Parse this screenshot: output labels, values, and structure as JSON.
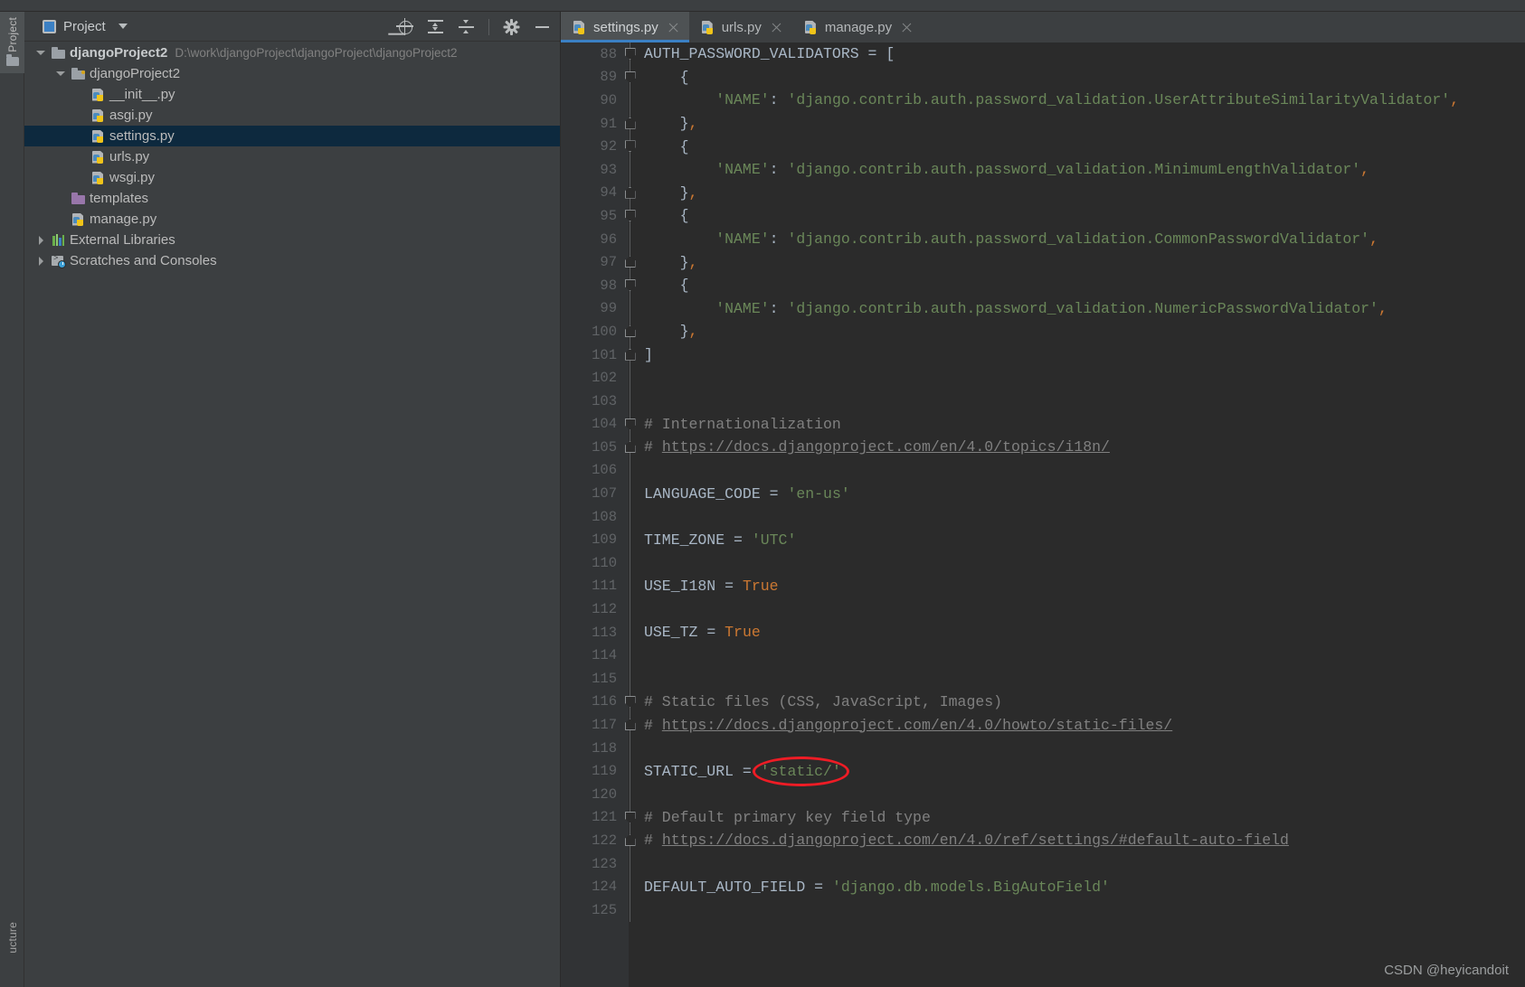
{
  "window": {
    "watermark": "CSDN @heyicandoit"
  },
  "rail": {
    "project_label": "Project",
    "structure_label": "ucture"
  },
  "project_panel": {
    "title": "Project",
    "icon": "project-window-icon",
    "tools": [
      {
        "name": "locate-in-tree-icon",
        "label": "Select Opened File"
      },
      {
        "name": "expand-all-icon",
        "label": "Expand All"
      },
      {
        "name": "collapse-all-icon",
        "label": "Collapse All"
      },
      {
        "name": "gear-icon",
        "label": "Options"
      },
      {
        "name": "minimize-icon",
        "label": "Hide"
      }
    ],
    "tree": [
      {
        "depth": 0,
        "arrow": "down",
        "icon": "folder-module-icon",
        "label": "djangoProject2",
        "bold": true,
        "path": "D:\\work\\djangoProject\\djangoProject\\djangoProject2",
        "selected": false
      },
      {
        "depth": 1,
        "arrow": "down",
        "icon": "folder-package-icon",
        "label": "djangoProject2",
        "bold": false,
        "path": "",
        "selected": false
      },
      {
        "depth": 2,
        "arrow": "none",
        "icon": "python-file-icon",
        "label": "__init__.py",
        "bold": false,
        "path": "",
        "selected": false
      },
      {
        "depth": 2,
        "arrow": "none",
        "icon": "python-file-icon",
        "label": "asgi.py",
        "bold": false,
        "path": "",
        "selected": false
      },
      {
        "depth": 2,
        "arrow": "none",
        "icon": "python-file-icon",
        "label": "settings.py",
        "bold": false,
        "path": "",
        "selected": true
      },
      {
        "depth": 2,
        "arrow": "none",
        "icon": "python-file-icon",
        "label": "urls.py",
        "bold": false,
        "path": "",
        "selected": false
      },
      {
        "depth": 2,
        "arrow": "none",
        "icon": "python-file-icon",
        "label": "wsgi.py",
        "bold": false,
        "path": "",
        "selected": false
      },
      {
        "depth": 1,
        "arrow": "none",
        "icon": "folder-templates-icon",
        "label": "templates",
        "bold": false,
        "path": "",
        "selected": false
      },
      {
        "depth": 1,
        "arrow": "none",
        "icon": "python-file-icon",
        "label": "manage.py",
        "bold": false,
        "path": "",
        "selected": false
      },
      {
        "depth": 0,
        "arrow": "right",
        "icon": "external-libraries-icon",
        "label": "External Libraries",
        "bold": false,
        "path": "",
        "selected": false
      },
      {
        "depth": 0,
        "arrow": "right",
        "icon": "scratches-icon",
        "label": "Scratches and Consoles",
        "bold": false,
        "path": "",
        "selected": false
      }
    ]
  },
  "editor": {
    "tabs": [
      {
        "label": "settings.py",
        "icon": "python-file-icon",
        "active": true,
        "closable": true
      },
      {
        "label": "urls.py",
        "icon": "python-file-icon",
        "active": false,
        "closable": true
      },
      {
        "label": "manage.py",
        "icon": "python-file-icon",
        "active": false,
        "closable": true
      }
    ],
    "first_line_number": 88,
    "annotation": {
      "type": "red-ellipse",
      "target_text": "'static/'",
      "color": "#ee1c25"
    },
    "lines": [
      {
        "n": 88,
        "fold": "open",
        "indent": 0,
        "tokens": [
          {
            "t": "AUTH_PASSWORD_VALIDATORS",
            "c": "tk-const"
          },
          {
            "t": " = ",
            "c": "tk-eq"
          },
          {
            "t": "[",
            "c": "tk-bracket"
          }
        ]
      },
      {
        "n": 89,
        "fold": "open",
        "indent": 1,
        "tokens": [
          {
            "t": "{",
            "c": "tk-bracket"
          }
        ]
      },
      {
        "n": 90,
        "fold": "pipe",
        "indent": 2,
        "tokens": [
          {
            "t": "'NAME'",
            "c": "tk-str"
          },
          {
            "t": ": ",
            "c": "tk-eq"
          },
          {
            "t": "'django.contrib.auth.password_validation.UserAttributeSimilarityValidator'",
            "c": "tk-str"
          },
          {
            "t": ",",
            "c": "tk-punct"
          }
        ]
      },
      {
        "n": 91,
        "fold": "close",
        "indent": 1,
        "tokens": [
          {
            "t": "}",
            "c": "tk-bracket"
          },
          {
            "t": ",",
            "c": "tk-punct"
          }
        ]
      },
      {
        "n": 92,
        "fold": "open",
        "indent": 1,
        "tokens": [
          {
            "t": "{",
            "c": "tk-bracket"
          }
        ]
      },
      {
        "n": 93,
        "fold": "pipe",
        "indent": 2,
        "tokens": [
          {
            "t": "'NAME'",
            "c": "tk-str"
          },
          {
            "t": ": ",
            "c": "tk-eq"
          },
          {
            "t": "'django.contrib.auth.password_validation.MinimumLengthValidator'",
            "c": "tk-str"
          },
          {
            "t": ",",
            "c": "tk-punct"
          }
        ]
      },
      {
        "n": 94,
        "fold": "close",
        "indent": 1,
        "tokens": [
          {
            "t": "}",
            "c": "tk-bracket"
          },
          {
            "t": ",",
            "c": "tk-punct"
          }
        ]
      },
      {
        "n": 95,
        "fold": "open",
        "indent": 1,
        "tokens": [
          {
            "t": "{",
            "c": "tk-bracket"
          }
        ]
      },
      {
        "n": 96,
        "fold": "pipe",
        "indent": 2,
        "tokens": [
          {
            "t": "'NAME'",
            "c": "tk-str"
          },
          {
            "t": ": ",
            "c": "tk-eq"
          },
          {
            "t": "'django.contrib.auth.password_validation.CommonPasswordValidator'",
            "c": "tk-str"
          },
          {
            "t": ",",
            "c": "tk-punct"
          }
        ]
      },
      {
        "n": 97,
        "fold": "close",
        "indent": 1,
        "tokens": [
          {
            "t": "}",
            "c": "tk-bracket"
          },
          {
            "t": ",",
            "c": "tk-punct"
          }
        ]
      },
      {
        "n": 98,
        "fold": "open",
        "indent": 1,
        "tokens": [
          {
            "t": "{",
            "c": "tk-bracket"
          }
        ]
      },
      {
        "n": 99,
        "fold": "pipe",
        "indent": 2,
        "tokens": [
          {
            "t": "'NAME'",
            "c": "tk-str"
          },
          {
            "t": ": ",
            "c": "tk-eq"
          },
          {
            "t": "'django.contrib.auth.password_validation.NumericPasswordValidator'",
            "c": "tk-str"
          },
          {
            "t": ",",
            "c": "tk-punct"
          }
        ]
      },
      {
        "n": 100,
        "fold": "close",
        "indent": 1,
        "tokens": [
          {
            "t": "}",
            "c": "tk-bracket"
          },
          {
            "t": ",",
            "c": "tk-punct"
          }
        ]
      },
      {
        "n": 101,
        "fold": "close",
        "indent": 0,
        "tokens": [
          {
            "t": "]",
            "c": "tk-bracket"
          }
        ]
      },
      {
        "n": 102,
        "fold": "none",
        "indent": 0,
        "tokens": []
      },
      {
        "n": 103,
        "fold": "none",
        "indent": 0,
        "tokens": []
      },
      {
        "n": 104,
        "fold": "open",
        "indent": 0,
        "tokens": [
          {
            "t": "# Internationalization",
            "c": "tk-comment"
          }
        ]
      },
      {
        "n": 105,
        "fold": "close",
        "indent": 0,
        "tokens": [
          {
            "t": "# ",
            "c": "tk-comment"
          },
          {
            "t": "https://docs.djangoproject.com/en/4.0/topics/i18n/",
            "c": "tk-link"
          }
        ]
      },
      {
        "n": 106,
        "fold": "none",
        "indent": 0,
        "tokens": []
      },
      {
        "n": 107,
        "fold": "none",
        "indent": 0,
        "tokens": [
          {
            "t": "LANGUAGE_CODE",
            "c": "tk-const"
          },
          {
            "t": " = ",
            "c": "tk-eq"
          },
          {
            "t": "'en-us'",
            "c": "tk-str"
          }
        ]
      },
      {
        "n": 108,
        "fold": "none",
        "indent": 0,
        "tokens": []
      },
      {
        "n": 109,
        "fold": "none",
        "indent": 0,
        "tokens": [
          {
            "t": "TIME_ZONE",
            "c": "tk-const"
          },
          {
            "t": " = ",
            "c": "tk-eq"
          },
          {
            "t": "'UTC'",
            "c": "tk-str"
          }
        ]
      },
      {
        "n": 110,
        "fold": "none",
        "indent": 0,
        "tokens": []
      },
      {
        "n": 111,
        "fold": "none",
        "indent": 0,
        "tokens": [
          {
            "t": "USE_I18N",
            "c": "tk-const"
          },
          {
            "t": " = ",
            "c": "tk-eq"
          },
          {
            "t": "True",
            "c": "tk-kw"
          }
        ]
      },
      {
        "n": 112,
        "fold": "none",
        "indent": 0,
        "tokens": []
      },
      {
        "n": 113,
        "fold": "none",
        "indent": 0,
        "tokens": [
          {
            "t": "USE_TZ",
            "c": "tk-const"
          },
          {
            "t": " = ",
            "c": "tk-eq"
          },
          {
            "t": "True",
            "c": "tk-kw"
          }
        ]
      },
      {
        "n": 114,
        "fold": "none",
        "indent": 0,
        "tokens": []
      },
      {
        "n": 115,
        "fold": "none",
        "indent": 0,
        "tokens": []
      },
      {
        "n": 116,
        "fold": "open",
        "indent": 0,
        "tokens": [
          {
            "t": "# Static files (CSS, JavaScript, Images)",
            "c": "tk-comment"
          }
        ]
      },
      {
        "n": 117,
        "fold": "close",
        "indent": 0,
        "tokens": [
          {
            "t": "# ",
            "c": "tk-comment"
          },
          {
            "t": "https://docs.djangoproject.com/en/4.0/howto/static-files/",
            "c": "tk-link"
          }
        ]
      },
      {
        "n": 118,
        "fold": "none",
        "indent": 0,
        "tokens": []
      },
      {
        "n": 119,
        "fold": "none",
        "indent": 0,
        "tokens": [
          {
            "t": "STATIC_URL",
            "c": "tk-const"
          },
          {
            "t": " = ",
            "c": "tk-eq"
          },
          {
            "t": "'static/'",
            "c": "tk-str"
          }
        ]
      },
      {
        "n": 120,
        "fold": "none",
        "indent": 0,
        "tokens": []
      },
      {
        "n": 121,
        "fold": "open",
        "indent": 0,
        "tokens": [
          {
            "t": "# Default primary key field type",
            "c": "tk-comment"
          }
        ]
      },
      {
        "n": 122,
        "fold": "close",
        "indent": 0,
        "tokens": [
          {
            "t": "# ",
            "c": "tk-comment"
          },
          {
            "t": "https://docs.djangoproject.com/en/4.0/ref/settings/#default-auto-field",
            "c": "tk-link"
          }
        ]
      },
      {
        "n": 123,
        "fold": "none",
        "indent": 0,
        "tokens": []
      },
      {
        "n": 124,
        "fold": "none",
        "indent": 0,
        "tokens": [
          {
            "t": "DEFAULT_AUTO_FIELD",
            "c": "tk-const"
          },
          {
            "t": " = ",
            "c": "tk-eq"
          },
          {
            "t": "'django.db.models.BigAutoField'",
            "c": "tk-str"
          }
        ]
      },
      {
        "n": 125,
        "fold": "none",
        "indent": 0,
        "tokens": []
      }
    ]
  }
}
